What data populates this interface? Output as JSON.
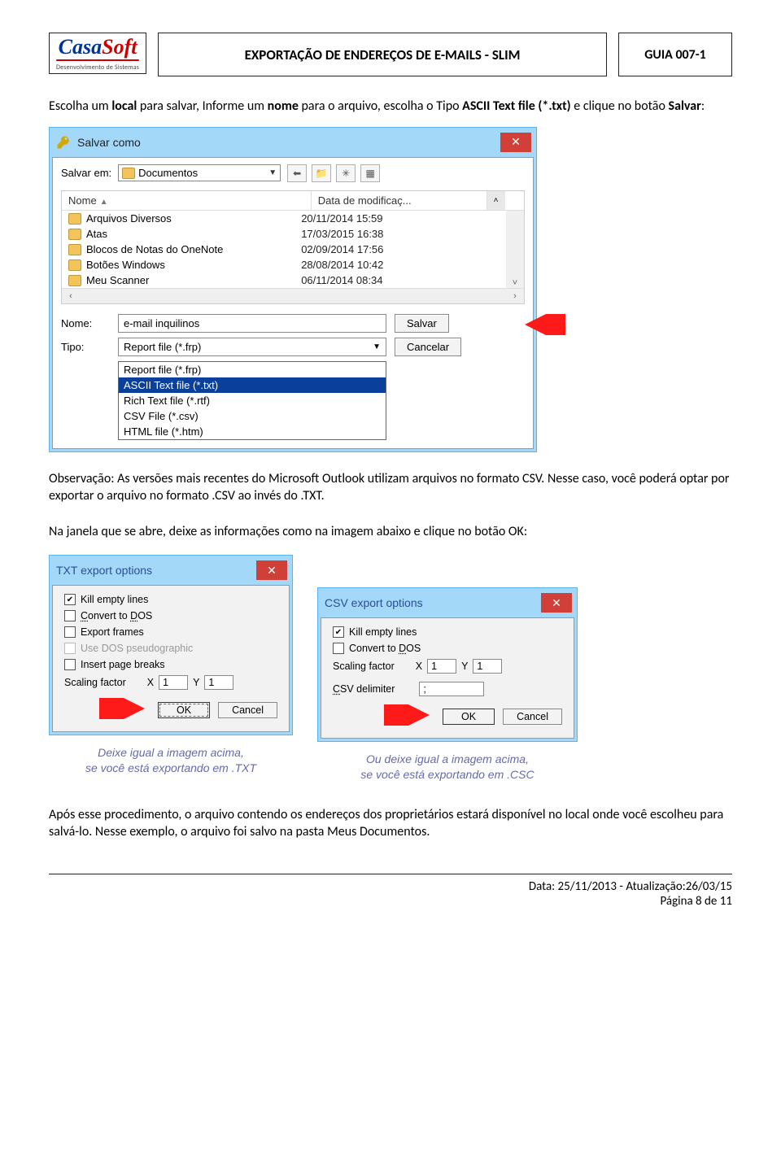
{
  "header": {
    "logo_main_1": "Casa",
    "logo_main_2": "Soft",
    "logo_sub": "Desenvolvimento de Sistemas",
    "title": "EXPORTAÇÃO DE ENDEREÇOS DE E-MAILS - SLIM",
    "guide": "GUIA 007-1"
  },
  "intro": {
    "p1a": "Escolha um ",
    "p1b": "local",
    "p1c": " para salvar, Informe um ",
    "p1d": "nome",
    "p1e": " para o arquivo, escolha o Tipo ",
    "p1f": "ASCII Text file (*.txt)",
    "p1g": " e clique no botão ",
    "p1h": "Salvar",
    "p1i": ":"
  },
  "saveas": {
    "title": "Salvar como",
    "salvar_em_label": "Salvar em:",
    "folder_current": "Documentos",
    "col_name": "Nome",
    "col_date": "Data de modificaç...",
    "rows": [
      {
        "name": "Arquivos Diversos",
        "date": "20/11/2014 15:59"
      },
      {
        "name": "Atas",
        "date": "17/03/2015 16:38"
      },
      {
        "name": "Blocos de Notas do OneNote",
        "date": "02/09/2014 17:56"
      },
      {
        "name": "Botões Windows",
        "date": "28/08/2014 10:42"
      },
      {
        "name": "Meu Scanner",
        "date": "06/11/2014 08:34"
      }
    ],
    "nome_label": "Nome:",
    "nome_value": "e-mail inquilinos",
    "salvar_btn": "Salvar",
    "tipo_label": "Tipo:",
    "tipo_value": "Report file (*.frp)",
    "cancel_btn": "Cancelar",
    "types": [
      "Report file (*.frp)",
      "ASCII Text file (*.txt)",
      "Rich Text file (*.rtf)",
      "CSV File (*.csv)",
      "HTML file (*.htm)"
    ],
    "type_selected_index": 1
  },
  "obs": {
    "label": "Observação:",
    "text1": " As versões mais recentes do Microsoft Outlook utilizam arquivos no formato CSV. Nesse caso, você poderá optar por exportar o arquivo no formato .CSV ao invés do .TXT."
  },
  "note_txt": {
    "t1": "Na janela que se abre, deixe as informações como na imagem abaixo e clique no botão ",
    "t2": "OK",
    "t3": ":"
  },
  "txt_dialog": {
    "title": "TXT export options",
    "kill_empty": "Kill empty lines",
    "convert_dos": "Convert to DOS",
    "export_frames": "Export frames",
    "use_pseudo": "Use DOS pseudographic",
    "insert_breaks": "Insert page breaks",
    "scaling": "Scaling factor",
    "x": "X",
    "xval": "1",
    "y": "Y",
    "yval": "1",
    "ok": "OK",
    "cancel": "Cancel",
    "caption_l1": "Deixe igual a imagem acima,",
    "caption_l2": "se você está exportando em .TXT"
  },
  "csv_dialog": {
    "title": "CSV export options",
    "kill_empty": "Kill empty lines",
    "convert_dos": "Convert to DOS",
    "scaling": "Scaling factor",
    "x": "X",
    "xval": "1",
    "y": "Y",
    "yval": "1",
    "csv_delim_label": "CSV delimiter",
    "csv_delim_value": ";",
    "ok": "OK",
    "cancel": "Cancel",
    "caption_l1": "Ou deixe igual a imagem acima,",
    "caption_l2": "se você está exportando em .CSC"
  },
  "after": {
    "text": "Após esse procedimento, o arquivo contendo os endereços dos proprietários estará disponível no local onde você escolheu para salvá-lo. Nesse exemplo, o arquivo foi salvo na pasta Meus Documentos."
  },
  "footer": {
    "line1": "Data: 25/11/2013 - Atualização:26/03/15",
    "line2": "Página 8 de 11"
  }
}
